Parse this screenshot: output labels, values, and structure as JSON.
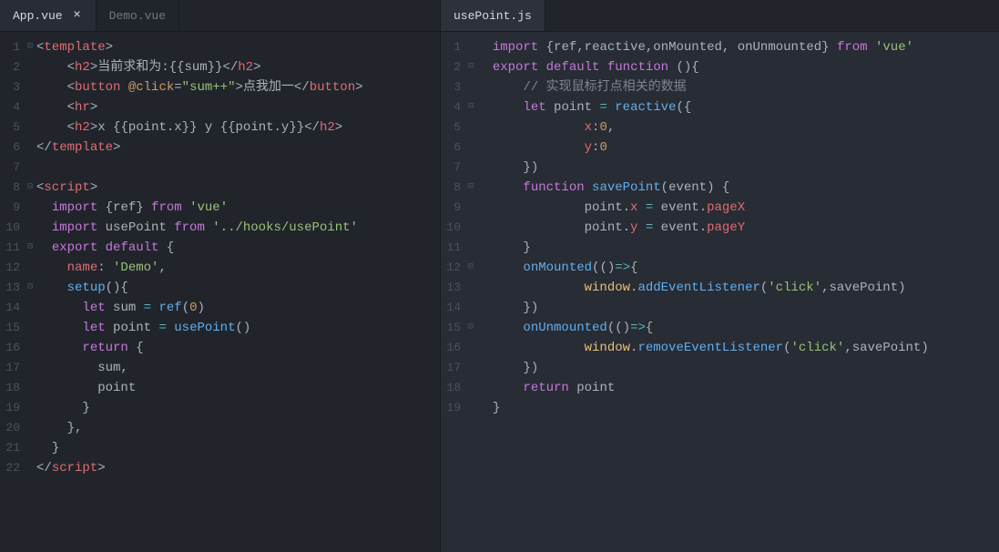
{
  "left": {
    "tabs": [
      {
        "label": "App.vue",
        "active": true
      },
      {
        "label": "Demo.vue",
        "active": false
      }
    ],
    "lines": [
      {
        "n": "1",
        "fold": "⊟",
        "tokens": [
          [
            "punct",
            "<"
          ],
          [
            "tag",
            "template"
          ],
          [
            "punct",
            ">"
          ]
        ]
      },
      {
        "n": "2",
        "fold": "",
        "tokens": [
          [
            "txt",
            "    "
          ],
          [
            "punct",
            "<"
          ],
          [
            "tag",
            "h2"
          ],
          [
            "punct",
            ">"
          ],
          [
            "txt",
            "当前求和为:"
          ],
          [
            "punct",
            "{{"
          ],
          [
            "txt",
            "sum"
          ],
          [
            "punct",
            "}}</"
          ],
          [
            "tag",
            "h2"
          ],
          [
            "punct",
            ">"
          ]
        ]
      },
      {
        "n": "3",
        "fold": "",
        "tokens": [
          [
            "txt",
            "    "
          ],
          [
            "punct",
            "<"
          ],
          [
            "tag",
            "button"
          ],
          [
            "txt",
            " "
          ],
          [
            "attr",
            "@click"
          ],
          [
            "punct",
            "="
          ],
          [
            "str",
            "\"sum++\""
          ],
          [
            "punct",
            ">"
          ],
          [
            "txt",
            "点我加一"
          ],
          [
            "punct",
            "</"
          ],
          [
            "tag",
            "button"
          ],
          [
            "punct",
            ">"
          ]
        ]
      },
      {
        "n": "4",
        "fold": "",
        "tokens": [
          [
            "txt",
            "    "
          ],
          [
            "punct",
            "<"
          ],
          [
            "tag",
            "hr"
          ],
          [
            "punct",
            ">"
          ]
        ]
      },
      {
        "n": "5",
        "fold": "",
        "tokens": [
          [
            "txt",
            "    "
          ],
          [
            "punct",
            "<"
          ],
          [
            "tag",
            "h2"
          ],
          [
            "punct",
            ">"
          ],
          [
            "txt",
            "x "
          ],
          [
            "punct",
            "{{"
          ],
          [
            "txt",
            "point.x"
          ],
          [
            "punct",
            "}}"
          ],
          [
            "txt",
            " y "
          ],
          [
            "punct",
            "{{"
          ],
          [
            "txt",
            "point.y"
          ],
          [
            "punct",
            "}}</"
          ],
          [
            "tag",
            "h2"
          ],
          [
            "punct",
            ">"
          ]
        ]
      },
      {
        "n": "6",
        "fold": "",
        "tokens": [
          [
            "punct",
            "</"
          ],
          [
            "tag",
            "template"
          ],
          [
            "punct",
            ">"
          ]
        ]
      },
      {
        "n": "7",
        "fold": "",
        "tokens": []
      },
      {
        "n": "8",
        "fold": "⊟",
        "tokens": [
          [
            "punct",
            "<"
          ],
          [
            "tag",
            "script"
          ],
          [
            "punct",
            ">"
          ]
        ]
      },
      {
        "n": "9",
        "fold": "",
        "tokens": [
          [
            "txt",
            "  "
          ],
          [
            "kw",
            "import"
          ],
          [
            "txt",
            " "
          ],
          [
            "punct",
            "{"
          ],
          [
            "txt",
            "ref"
          ],
          [
            "punct",
            "}"
          ],
          [
            "txt",
            " "
          ],
          [
            "kw",
            "from"
          ],
          [
            "txt",
            " "
          ],
          [
            "str",
            "'vue'"
          ]
        ]
      },
      {
        "n": "10",
        "fold": "",
        "tokens": [
          [
            "txt",
            "  "
          ],
          [
            "kw",
            "import"
          ],
          [
            "txt",
            " usePoint "
          ],
          [
            "kw",
            "from"
          ],
          [
            "txt",
            " "
          ],
          [
            "str",
            "'../hooks/usePoint'"
          ]
        ]
      },
      {
        "n": "11",
        "fold": "⊟",
        "tokens": [
          [
            "txt",
            "  "
          ],
          [
            "kw",
            "export"
          ],
          [
            "txt",
            " "
          ],
          [
            "kw",
            "default"
          ],
          [
            "txt",
            " "
          ],
          [
            "punct",
            "{"
          ]
        ]
      },
      {
        "n": "12",
        "fold": "",
        "tokens": [
          [
            "txt",
            "    "
          ],
          [
            "prop",
            "name"
          ],
          [
            "punct",
            ":"
          ],
          [
            "txt",
            " "
          ],
          [
            "str",
            "'Demo'"
          ],
          [
            "punct",
            ","
          ]
        ]
      },
      {
        "n": "13",
        "fold": "⊟",
        "tokens": [
          [
            "txt",
            "    "
          ],
          [
            "fn",
            "setup"
          ],
          [
            "punct",
            "(){"
          ],
          [
            "txt",
            ""
          ]
        ]
      },
      {
        "n": "14",
        "fold": "",
        "tokens": [
          [
            "txt",
            "      "
          ],
          [
            "kw",
            "let"
          ],
          [
            "txt",
            " sum "
          ],
          [
            "op",
            "="
          ],
          [
            "txt",
            " "
          ],
          [
            "fn",
            "ref"
          ],
          [
            "punct",
            "("
          ],
          [
            "num",
            "0"
          ],
          [
            "punct",
            ")"
          ]
        ]
      },
      {
        "n": "15",
        "fold": "",
        "tokens": [
          [
            "txt",
            "      "
          ],
          [
            "kw",
            "let"
          ],
          [
            "txt",
            " point "
          ],
          [
            "op",
            "="
          ],
          [
            "txt",
            " "
          ],
          [
            "fn",
            "usePoint"
          ],
          [
            "punct",
            "()"
          ]
        ]
      },
      {
        "n": "16",
        "fold": "",
        "tokens": [
          [
            "txt",
            "      "
          ],
          [
            "kw",
            "return"
          ],
          [
            "txt",
            " "
          ],
          [
            "punct",
            "{"
          ]
        ]
      },
      {
        "n": "17",
        "fold": "",
        "tokens": [
          [
            "txt",
            "        sum"
          ],
          [
            "punct",
            ","
          ]
        ]
      },
      {
        "n": "18",
        "fold": "",
        "tokens": [
          [
            "txt",
            "        point"
          ]
        ]
      },
      {
        "n": "19",
        "fold": "",
        "tokens": [
          [
            "txt",
            "      "
          ],
          [
            "punct",
            "}"
          ]
        ]
      },
      {
        "n": "20",
        "fold": "",
        "tokens": [
          [
            "txt",
            "    "
          ],
          [
            "punct",
            "},"
          ]
        ]
      },
      {
        "n": "21",
        "fold": "",
        "tokens": [
          [
            "txt",
            "  "
          ],
          [
            "punct",
            "}"
          ]
        ]
      },
      {
        "n": "22",
        "fold": "",
        "tokens": [
          [
            "punct",
            "</"
          ],
          [
            "tag",
            "script"
          ],
          [
            "punct",
            ">"
          ]
        ]
      }
    ]
  },
  "right": {
    "tabs": [
      {
        "label": "usePoint.js",
        "active": true
      }
    ],
    "lines": [
      {
        "n": "1",
        "fold": "",
        "tokens": [
          [
            "txt",
            "  "
          ],
          [
            "kw",
            "import"
          ],
          [
            "txt",
            " "
          ],
          [
            "punct",
            "{"
          ],
          [
            "txt",
            "ref"
          ],
          [
            "punct",
            ","
          ],
          [
            "txt",
            "reactive"
          ],
          [
            "punct",
            ","
          ],
          [
            "txt",
            "onMounted"
          ],
          [
            "punct",
            ","
          ],
          [
            "txt",
            " onUnmounted"
          ],
          [
            "punct",
            "}"
          ],
          [
            "txt",
            " "
          ],
          [
            "kw",
            "from"
          ],
          [
            "txt",
            " "
          ],
          [
            "str",
            "'vue'"
          ]
        ]
      },
      {
        "n": "2",
        "fold": "⊟",
        "tokens": [
          [
            "txt",
            "  "
          ],
          [
            "kw",
            "export"
          ],
          [
            "txt",
            " "
          ],
          [
            "kw",
            "default"
          ],
          [
            "txt",
            " "
          ],
          [
            "kw",
            "function"
          ],
          [
            "txt",
            " "
          ],
          [
            "punct",
            "(){"
          ],
          [
            "txt",
            ""
          ]
        ]
      },
      {
        "n": "3",
        "fold": "",
        "tokens": [
          [
            "txt",
            "      "
          ],
          [
            "cmt",
            "// 实现鼠标打点相关的数据"
          ]
        ]
      },
      {
        "n": "4",
        "fold": "⊟",
        "tokens": [
          [
            "txt",
            "      "
          ],
          [
            "kw",
            "let"
          ],
          [
            "txt",
            " point "
          ],
          [
            "op",
            "="
          ],
          [
            "txt",
            " "
          ],
          [
            "fn",
            "reactive"
          ],
          [
            "punct",
            "({"
          ],
          [
            "txt",
            ""
          ]
        ]
      },
      {
        "n": "5",
        "fold": "",
        "tokens": [
          [
            "txt",
            "              "
          ],
          [
            "prop",
            "x"
          ],
          [
            "punct",
            ":"
          ],
          [
            "num",
            "0"
          ],
          [
            "punct",
            ","
          ]
        ]
      },
      {
        "n": "6",
        "fold": "",
        "tokens": [
          [
            "txt",
            "              "
          ],
          [
            "prop",
            "y"
          ],
          [
            "punct",
            ":"
          ],
          [
            "num",
            "0"
          ]
        ]
      },
      {
        "n": "7",
        "fold": "",
        "tokens": [
          [
            "txt",
            "      "
          ],
          [
            "punct",
            "})"
          ]
        ]
      },
      {
        "n": "8",
        "fold": "⊟",
        "tokens": [
          [
            "txt",
            "      "
          ],
          [
            "kw",
            "function"
          ],
          [
            "txt",
            " "
          ],
          [
            "fn",
            "savePoint"
          ],
          [
            "punct",
            "("
          ],
          [
            "txt",
            "event"
          ],
          [
            "punct",
            ")"
          ],
          [
            "txt",
            " "
          ],
          [
            "punct",
            "{"
          ]
        ]
      },
      {
        "n": "9",
        "fold": "",
        "tokens": [
          [
            "txt",
            "              point"
          ],
          [
            "punct",
            "."
          ],
          [
            "prop",
            "x"
          ],
          [
            "txt",
            " "
          ],
          [
            "op",
            "="
          ],
          [
            "txt",
            " event"
          ],
          [
            "punct",
            "."
          ],
          [
            "prop",
            "pageX"
          ]
        ]
      },
      {
        "n": "10",
        "fold": "",
        "tokens": [
          [
            "txt",
            "              point"
          ],
          [
            "punct",
            "."
          ],
          [
            "prop",
            "y"
          ],
          [
            "txt",
            " "
          ],
          [
            "op",
            "="
          ],
          [
            "txt",
            " event"
          ],
          [
            "punct",
            "."
          ],
          [
            "prop",
            "pageY"
          ]
        ]
      },
      {
        "n": "11",
        "fold": "",
        "tokens": [
          [
            "txt",
            "      "
          ],
          [
            "punct",
            "}"
          ]
        ]
      },
      {
        "n": "12",
        "fold": "⊟",
        "tokens": [
          [
            "txt",
            "      "
          ],
          [
            "fn",
            "onMounted"
          ],
          [
            "punct",
            "(()"
          ],
          [
            "op",
            "=>"
          ],
          [
            "punct",
            "{"
          ]
        ]
      },
      {
        "n": "13",
        "fold": "",
        "tokens": [
          [
            "txt",
            "              "
          ],
          [
            "yellow",
            "window"
          ],
          [
            "punct",
            "."
          ],
          [
            "fn",
            "addEventListener"
          ],
          [
            "punct",
            "("
          ],
          [
            "str",
            "'click'"
          ],
          [
            "punct",
            ","
          ],
          [
            "txt",
            "savePoint"
          ],
          [
            "punct",
            ")"
          ]
        ]
      },
      {
        "n": "14",
        "fold": "",
        "tokens": [
          [
            "txt",
            "      "
          ],
          [
            "punct",
            "})"
          ]
        ]
      },
      {
        "n": "15",
        "fold": "⊟",
        "tokens": [
          [
            "txt",
            "      "
          ],
          [
            "fn",
            "onUnmounted"
          ],
          [
            "punct",
            "(()"
          ],
          [
            "op",
            "=>"
          ],
          [
            "punct",
            "{"
          ]
        ]
      },
      {
        "n": "16",
        "fold": "",
        "tokens": [
          [
            "txt",
            "              "
          ],
          [
            "yellow",
            "window"
          ],
          [
            "punct",
            "."
          ],
          [
            "fn",
            "removeEventListener"
          ],
          [
            "punct",
            "("
          ],
          [
            "str",
            "'click'"
          ],
          [
            "punct",
            ","
          ],
          [
            "txt",
            "savePoint"
          ],
          [
            "punct",
            ")"
          ]
        ]
      },
      {
        "n": "17",
        "fold": "",
        "tokens": [
          [
            "txt",
            "      "
          ],
          [
            "punct",
            "})"
          ]
        ]
      },
      {
        "n": "18",
        "fold": "",
        "tokens": [
          [
            "txt",
            "      "
          ],
          [
            "kw",
            "return"
          ],
          [
            "txt",
            " point"
          ]
        ]
      },
      {
        "n": "19",
        "fold": "",
        "tokens": [
          [
            "txt",
            "  "
          ],
          [
            "punct",
            "}"
          ]
        ]
      }
    ]
  }
}
